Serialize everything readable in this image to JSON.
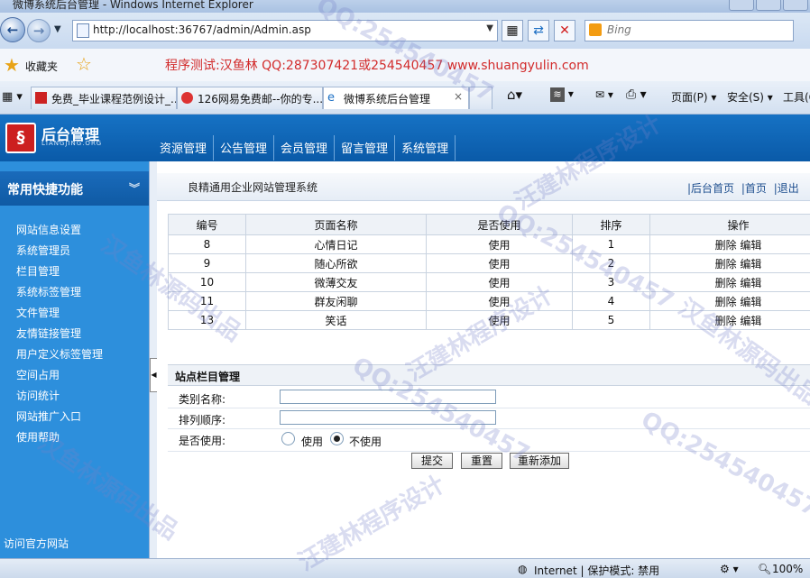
{
  "window": {
    "title": "微博系统后台管理 - Windows Internet Explorer"
  },
  "address": {
    "url": "http://localhost:36767/admin/Admin.asp",
    "search_placeholder": "Bing"
  },
  "favorites": {
    "label": "收藏夹",
    "banner": "程序测试:汉鱼林 QQ:287307421或254540457 www.shuangyulin.com"
  },
  "tabs": [
    {
      "label": "免费_毕业课程范例设计_..."
    },
    {
      "label": "126网易免费邮--你的专..."
    },
    {
      "label": "微博系统后台管理"
    }
  ],
  "commands": {
    "page": "页面(P)",
    "safety": "安全(S)",
    "tools": "工具(O"
  },
  "header": {
    "logo_title": "后台管理",
    "logo_sub": "LIANGJING.ORG",
    "menu": [
      "资源管理",
      "公告管理",
      "会员管理",
      "留言管理",
      "系统管理"
    ]
  },
  "sidebar": {
    "title": "常用快捷功能",
    "collapse": "︾",
    "items": [
      "网站信息设置",
      "系统管理员",
      "栏目管理",
      "系统标签管理",
      "文件管理",
      "友情链接管理",
      "用户定义标签管理",
      "空间占用",
      "访问统计",
      "网站推广入口",
      "使用帮助"
    ],
    "footer": "访问官方网站"
  },
  "crumb": {
    "title": "良精通用企业网站管理系统",
    "links": [
      "|后台首页",
      "|首页",
      "|退出"
    ]
  },
  "table": {
    "headers": [
      "编号",
      "页面名称",
      "是否使用",
      "排序",
      "操作"
    ],
    "rows": [
      {
        "id": "8",
        "name": "心情日记",
        "use": "使用",
        "order": "1"
      },
      {
        "id": "9",
        "name": "随心所欲",
        "use": "使用",
        "order": "2"
      },
      {
        "id": "10",
        "name": "微薄交友",
        "use": "使用",
        "order": "3"
      },
      {
        "id": "11",
        "name": "群友闲聊",
        "use": "使用",
        "order": "4"
      },
      {
        "id": "13",
        "name": "笑话",
        "use": "使用",
        "order": "5"
      }
    ],
    "delete_label": "删除",
    "edit_label": "编辑"
  },
  "form": {
    "title": "站点栏目管理",
    "name_label": "类别名称:",
    "name_value": "",
    "order_label": "排列顺序:",
    "order_value": "",
    "use_label": "是否使用:",
    "opt_use": "使用",
    "opt_nouse": "不使用",
    "selected": "不使用",
    "submit": "提交",
    "reset": "重置",
    "readd": "重新添加"
  },
  "status": {
    "zone": "Internet | 保护模式: 禁用",
    "zoom": "100%"
  },
  "watermarks": [
    "QQ:254540457",
    "汉鱼林源码出品",
    "汪建林程序设计"
  ]
}
